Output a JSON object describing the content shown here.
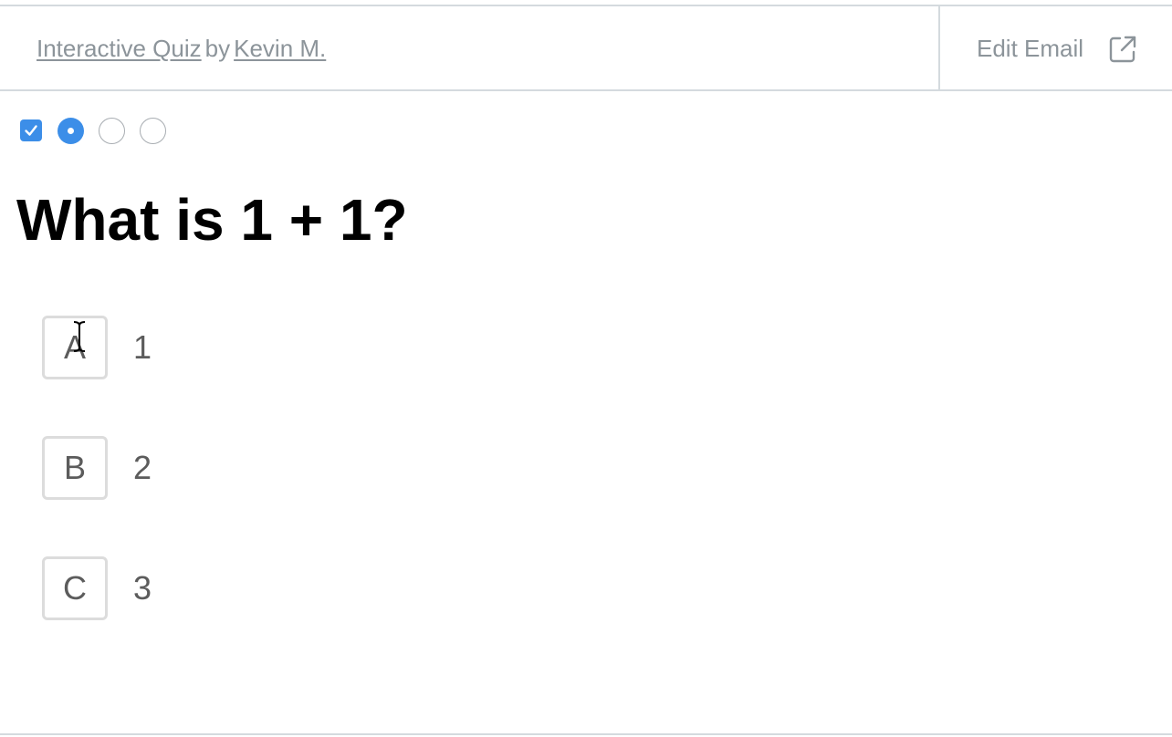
{
  "header": {
    "quiz_link": "Interactive Quiz",
    "by_text": "by",
    "author_link": "Kevin M.",
    "edit_email_label": "Edit Email",
    "edit_email_icon": "external-link-icon"
  },
  "progress": {
    "total_steps": 4,
    "completed_steps": 1,
    "current_step": 2,
    "accent_color": "#3c8ee8"
  },
  "question": {
    "text": "What is 1 + 1?"
  },
  "answers": [
    {
      "key": "A",
      "value": "1"
    },
    {
      "key": "B",
      "value": "2"
    },
    {
      "key": "C",
      "value": "3"
    }
  ],
  "colors": {
    "muted_text": "#8c949a",
    "border": "#d4dade",
    "answer_text": "#5c5c5c"
  }
}
